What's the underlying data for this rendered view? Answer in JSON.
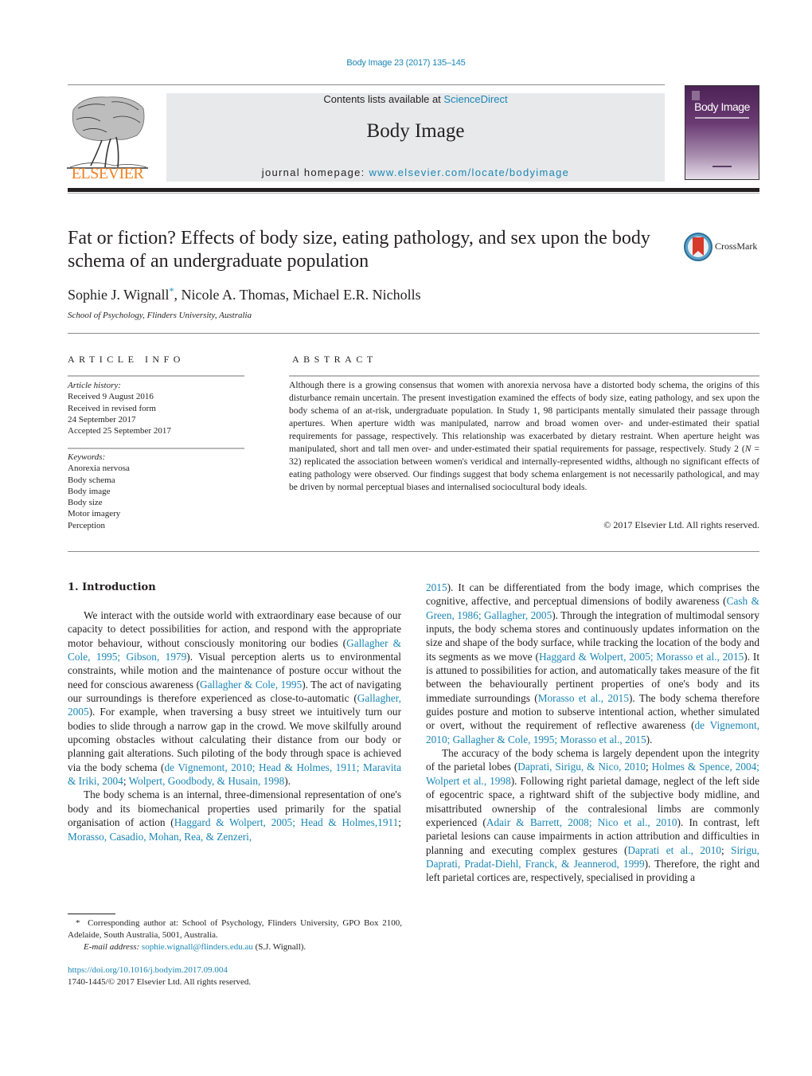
{
  "header": {
    "citation": "Body Image 23 (2017) 135–145",
    "contents_prefix": "Contents lists available at ",
    "contents_link": "ScienceDirect",
    "journal_name": "Body Image",
    "homepage_prefix": "journal homepage: ",
    "homepage_link": "www.elsevier.com/locate/bodyimage",
    "publisher_logo_text": "ELSEVIER",
    "cover_title": "Body Image",
    "crossmark_label": "CrossMark"
  },
  "article": {
    "title": "Fat or fiction? Effects of body size, eating pathology, and sex upon the body schema of an undergraduate population",
    "authors": [
      {
        "name": "Sophie J. Wignall",
        "corresponding": "*"
      },
      {
        "name": "Nicole A. Thomas"
      },
      {
        "name": "Michael E.R. Nicholls"
      }
    ],
    "author_sep": ", ",
    "affiliation": "School of Psychology, Flinders University, Australia"
  },
  "article_info": {
    "heading": "ARTICLE INFO",
    "history_label": "Article history:",
    "history": [
      "Received 9 August 2016",
      "Received in revised form",
      "24 September 2017",
      "Accepted 25 September 2017"
    ],
    "keywords_label": "Keywords:",
    "keywords": [
      "Anorexia nervosa",
      "Body schema",
      "Body image",
      "Body size",
      "Motor imagery",
      "Perception"
    ]
  },
  "abstract": {
    "heading": "ABSTRACT",
    "text_part1": "Although there is a growing consensus that women with anorexia nervosa have a distorted body schema, the origins of this disturbance remain uncertain. The present investigation examined the effects of body size, eating pathology, and sex upon the body schema of an at-risk, undergraduate population. In Study 1, 98 participants mentally simulated their passage through apertures. When aperture width was manipulated, narrow and broad women over- and under-estimated their spatial requirements for passage, respectively. This relationship was exacerbated by dietary restraint. When aperture height was manipulated, short and tall men over- and under-estimated their spatial requirements for passage, respectively. Study 2 (",
    "n_symbol": "N",
    "text_part2": " = 32) replicated the association between women's veridical and internally-represented widths, although no significant effects of eating pathology were observed. Our findings suggest that body schema enlargement is not necessarily pathological, and may be driven by normal perceptual biases and internalised sociocultural body ideals.",
    "copyright": "© 2017 Elsevier Ltd. All rights reserved."
  },
  "introduction": {
    "heading": "1.  Introduction",
    "left_column": [
      [
        {
          "t": "We interact with the outside world with extraordinary ease because of our capacity to detect possibilities for action, and respond with the appropriate motor behaviour, without consciously monitoring our bodies ("
        },
        {
          "l": "Gallagher & Cole, 1995; Gibson, 1979"
        },
        {
          "t": "). Visual perception alerts us to environmental constraints, while motion and the maintenance of posture occur without the need for conscious awareness ("
        },
        {
          "l": "Gallagher & Cole, 1995"
        },
        {
          "t": "). The act of navigating our surroundings is therefore experienced as close-to-automatic ("
        },
        {
          "l": "Gallagher, 2005"
        },
        {
          "t": "). For example, when traversing a busy street we intuitively turn our bodies to slide through a narrow gap in the crowd. We move skilfully around upcoming obstacles without calculating their distance from our body or planning gait alterations. Such piloting of the body through space is achieved via the body schema ("
        },
        {
          "l": "de Vignemont, 2010; Head & Holmes, 1911; Maravita & Iriki, 2004"
        },
        {
          "t": "; "
        },
        {
          "l": "Wolpert, Goodbody, & Husain, 1998"
        },
        {
          "t": ")."
        }
      ],
      [
        {
          "t": "The body schema is an internal, three-dimensional representation of one's body and its biomechanical properties used primarily for the spatial organisation of action ("
        },
        {
          "l": "Haggard & Wolpert, 2005; Head & Holmes,1911"
        },
        {
          "t": "; "
        },
        {
          "l": "Morasso, Casadio, Mohan, Rea, & Zenzeri,"
        }
      ]
    ],
    "right_column": [
      [
        {
          "l": "2015"
        },
        {
          "t": "). It can be differentiated from the body image, which comprises the cognitive, affective, and perceptual dimensions of bodily awareness ("
        },
        {
          "l": "Cash & Green, 1986; Gallagher, 2005"
        },
        {
          "t": "). Through the integration of multimodal sensory inputs, the body schema stores and continuously updates information on the size and shape of the body surface, while tracking the location of the body and its segments as we move ("
        },
        {
          "l": "Haggard & Wolpert, 2005; Morasso et al., 2015"
        },
        {
          "t": "). It is attuned to possibilities for action, and automatically takes measure of the fit between the behaviourally pertinent properties of one's body and its immediate surroundings ("
        },
        {
          "l": "Morasso et al., 2015"
        },
        {
          "t": "). The body schema therefore guides posture and motion to subserve intentional action, whether simulated or overt, without the requirement of reflective awareness ("
        },
        {
          "l": "de Vignemont, 2010; Gallagher & Cole, 1995; Morasso et al., 2015"
        },
        {
          "t": ")."
        }
      ],
      [
        {
          "t": "The accuracy of the body schema is largely dependent upon the integrity of the parietal lobes ("
        },
        {
          "l": "Daprati, Sirigu, & Nico, 2010"
        },
        {
          "t": "; "
        },
        {
          "l": "Holmes & Spence, 2004; Wolpert et al., 1998"
        },
        {
          "t": "). Following right parietal damage, neglect of the left side of egocentric space, a rightward shift of the subjective body midline, and misattributed ownership of the contralesional limbs are commonly experienced ("
        },
        {
          "l": "Adair & Barrett, 2008; Nico et al., 2010"
        },
        {
          "t": "). In contrast, left parietal lesions can cause impairments in action attribution and difficulties in planning and executing complex gestures ("
        },
        {
          "l": "Daprati et al., 2010"
        },
        {
          "t": "; "
        },
        {
          "l": "Sirigu, Daprati, Pradat-Diehl, Franck, & Jeannerod, 1999"
        },
        {
          "t": "). Therefore, the right and left parietal cortices are, respectively, specialised in providing a"
        }
      ]
    ]
  },
  "footnotes": {
    "corresponding_marker": "*",
    "corresponding_text": "Corresponding author at: School of Psychology, Flinders University, GPO Box 2100, Adelaide, South Australia, 5001, Australia.",
    "email_label": "E-mail address: ",
    "email": "sophie.wignall@flinders.edu.au",
    "email_suffix": " (S.J. Wignall).",
    "doi": "https://doi.org/10.1016/j.bodyim.2017.09.004",
    "issn_line": "1740-1445/© 2017 Elsevier Ltd. All rights reserved."
  },
  "colors": {
    "link": "#1a86b5",
    "text": "#231f20",
    "publisher_orange": "#f08225",
    "masthead_gray": "#e8e9ea"
  }
}
